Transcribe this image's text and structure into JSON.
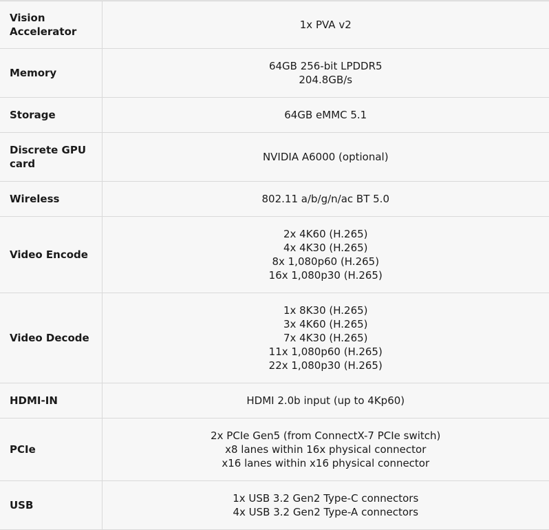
{
  "specs": [
    {
      "label": "Vision Accelerator",
      "values": [
        "1x PVA v2"
      ]
    },
    {
      "label": "Memory",
      "values": [
        "64GB 256-bit LPDDR5",
        "204.8GB/s"
      ]
    },
    {
      "label": "Storage",
      "values": [
        "64GB eMMC 5.1"
      ]
    },
    {
      "label": "Discrete GPU card",
      "values": [
        "NVIDIA A6000 (optional)"
      ]
    },
    {
      "label": "Wireless",
      "values": [
        "802.11 a/b/g/n/ac BT 5.0"
      ]
    },
    {
      "label": "Video Encode",
      "values": [
        "2x 4K60 (H.265)",
        "4x 4K30 (H.265)",
        "8x 1,080p60 (H.265)",
        "16x 1,080p30 (H.265)"
      ]
    },
    {
      "label": "Video Decode",
      "values": [
        "1x 8K30 (H.265)",
        "3x 4K60 (H.265)",
        "7x 4K30 (H.265)",
        "11x 1,080p60 (H.265)",
        "22x 1,080p30 (H.265)"
      ]
    },
    {
      "label": "HDMI-IN",
      "values": [
        "HDMI 2.0b input (up to 4Kp60)"
      ]
    },
    {
      "label": "PCIe",
      "values": [
        "2x PCIe Gen5 (from ConnectX-7 PCIe switch)",
        "x8 lanes within 16x physical connector",
        "x16 lanes within x16 physical connector"
      ]
    },
    {
      "label": "USB",
      "values": [
        "1x USB 3.2 Gen2 Type-C connectors",
        "4x USB 3.2 Gen2 Type-A connectors"
      ]
    }
  ]
}
